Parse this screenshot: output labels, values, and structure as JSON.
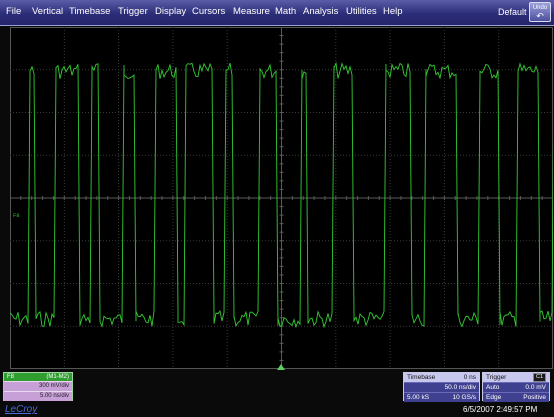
{
  "menu": {
    "items": [
      "File",
      "Vertical",
      "Timebase",
      "Trigger",
      "Display",
      "Cursors",
      "Measure",
      "Math",
      "Analysis",
      "Utilities",
      "Help"
    ],
    "default_label": "Default",
    "undo_label": "Undo"
  },
  "screen": {
    "trace_label": "F8",
    "trace_color": "#33cc33",
    "grid_color": "#3a3a3a"
  },
  "trace_box": {
    "name": "F8",
    "source": "(M1-M2)",
    "volts_per_div": "300 mV/div",
    "time_per_div": "5.00 ns/div",
    "header_color": "#2f9d2f",
    "row_color": "#c8a0d8"
  },
  "timebase": {
    "title": "Timebase",
    "delay": "0 ns",
    "time_per_div": "50.0 ns/div",
    "samples": "5.00 kS",
    "sample_rate": "10 GS/s"
  },
  "trigger": {
    "title": "Trigger",
    "channel": "C1",
    "mode": "Auto",
    "level": "0.0 mV",
    "type": "Edge",
    "slope": "Positive"
  },
  "footer": {
    "logo": "LeCroy",
    "timestamp": "6/5/2007 2:49:57 PM"
  }
}
